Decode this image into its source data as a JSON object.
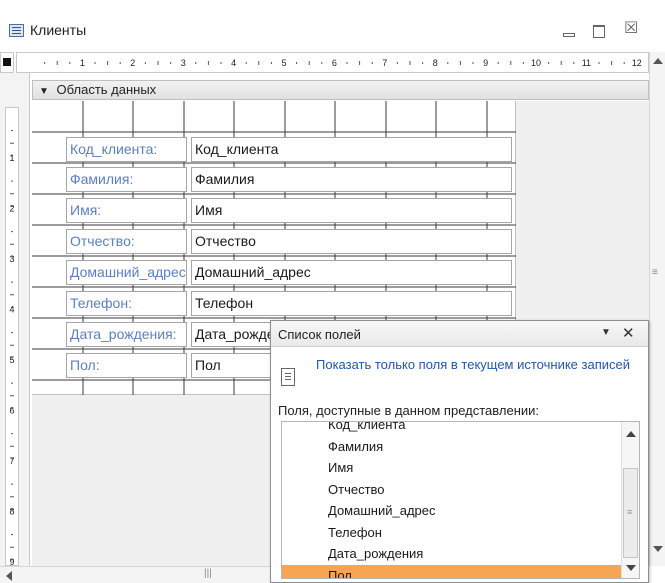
{
  "window": {
    "title": "Клиенты",
    "minimize_glyph": "",
    "maximize_glyph": "",
    "close_glyph": "☒"
  },
  "ruler": {
    "top_numbers": [
      "1",
      "2",
      "3",
      "4",
      "5",
      "6",
      "7",
      "8",
      "9",
      "10",
      "11",
      "12"
    ],
    "left_numbers": [
      "1",
      "2",
      "3",
      "4",
      "5",
      "6",
      "7",
      "8",
      "9"
    ]
  },
  "section": {
    "marker": "▼",
    "title": "Область данных"
  },
  "form_rows": [
    {
      "label": "Код_клиента:",
      "field": "Код_клиента"
    },
    {
      "label": "Фамилия:",
      "field": "Фамилия"
    },
    {
      "label": "Имя:",
      "field": "Имя"
    },
    {
      "label": "Отчество:",
      "field": "Отчество"
    },
    {
      "label": "Домашний_адрес",
      "field": "Домашний_адрес"
    },
    {
      "label": "Телефон:",
      "field": "Телефон"
    },
    {
      "label": "Дата_рождения:",
      "field": "Дата_рождения"
    },
    {
      "label": "Пол:",
      "field": "Пол"
    }
  ],
  "field_list": {
    "title": "Список полей",
    "dropdown_glyph": "▼",
    "close_glyph": "✕",
    "show_only_link": "Показать только поля в текущем источнике записей",
    "available_label": "Поля, доступные в данном представлении:",
    "items": [
      "Код_клиента",
      "Фамилия",
      "Имя",
      "Отчество",
      "Домашний_адрес",
      "Телефон",
      "Дата_рождения",
      "Пол"
    ],
    "selected_item": "Пол"
  },
  "scroll": {
    "grip_glyph": "≡",
    "h_grip_glyph": "|||"
  },
  "colors": {
    "label_text": "#5b7fc7",
    "link_text": "#1f57b4",
    "selected_item_bg": "#f6a555"
  }
}
